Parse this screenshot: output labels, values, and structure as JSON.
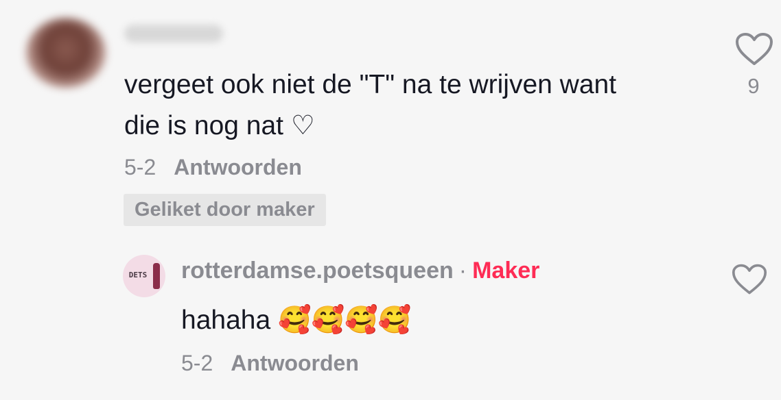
{
  "comment": {
    "text": "vergeet ook niet de \"T\" na te wrijven want\ndie is nog nat ♡",
    "date": "5-2",
    "reply_label": "Antwoorden",
    "liked_badge": "Geliket door maker",
    "like_count": "9",
    "icons": {
      "like": "heart-outline-icon"
    }
  },
  "reply": {
    "username": "rotterdamse.poetsqueen",
    "separator": "·",
    "creator_badge": "Maker",
    "text": "hahaha",
    "emojis": "🥰🥰🥰🥰",
    "date": "5-2",
    "reply_label": "Antwoorden",
    "avatar_text": "DETS",
    "icons": {
      "like": "heart-outline-icon"
    },
    "colors": {
      "creator_badge": "#fe2c55"
    }
  }
}
